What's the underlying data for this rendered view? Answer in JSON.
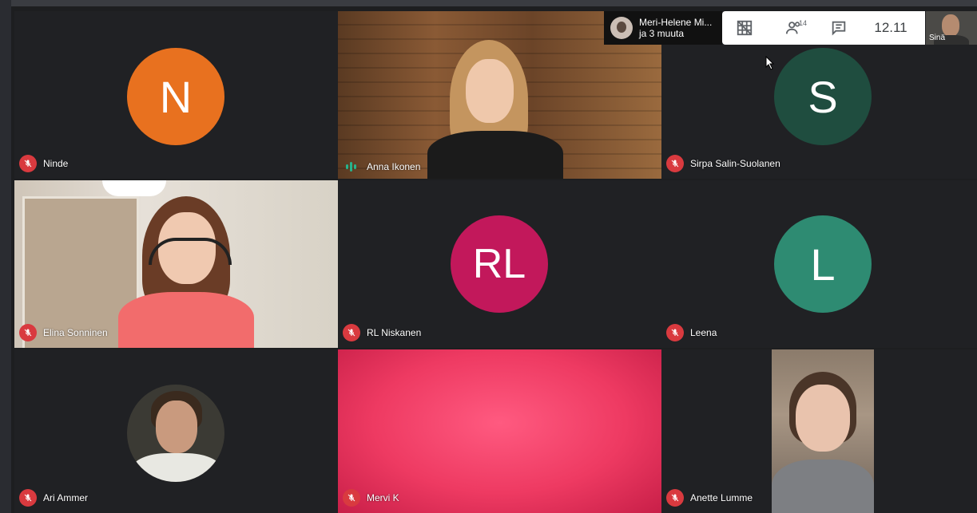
{
  "presenter": {
    "name": "Meri-Helene Mi...",
    "others": "ja 3 muuta"
  },
  "toolbar": {
    "participants_count": "14",
    "time": "12.11",
    "self_label": "Sinä"
  },
  "tiles": [
    {
      "name": "Ninde",
      "initial": "N",
      "color": "#e8711f",
      "muted": true
    },
    {
      "name": "Anna Ikonen",
      "muted": false,
      "speaking": true
    },
    {
      "name": "Sirpa Salin-Suolanen",
      "initial": "S",
      "color": "#1f4d3f",
      "muted": true
    },
    {
      "name": "Elina Sonninen",
      "muted": true
    },
    {
      "name": "RL Niskanen",
      "initial": "RL",
      "color": "#c2185b",
      "muted": true
    },
    {
      "name": "Leena",
      "initial": "L",
      "color": "#2e8b72",
      "muted": true
    },
    {
      "name": "Ari Ammer",
      "muted": true
    },
    {
      "name": "Mervi K",
      "muted": true
    },
    {
      "name": "Anette Lumme",
      "muted": true
    }
  ]
}
